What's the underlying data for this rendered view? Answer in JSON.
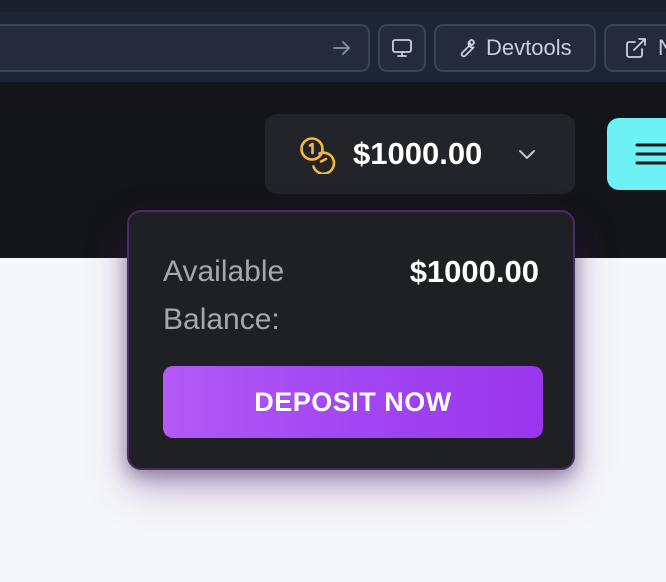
{
  "browser": {
    "url_value": "",
    "devtools_label": "Devtools",
    "new_label": "N",
    "icons": [
      "arrow-right-icon",
      "monitor-icon",
      "wrench-icon",
      "external-link-icon"
    ]
  },
  "header": {
    "balance_amount": "$1000.00",
    "icons": [
      "coins-icon",
      "chevron-down-icon",
      "menu-icon"
    ],
    "colors": {
      "header_bg": "#141518",
      "menu_button": "#6cf2f4",
      "coin": "#f5b83d"
    }
  },
  "balance_popover": {
    "label": "Available Balance:",
    "value": "$1000.00",
    "deposit_label": "DEPOSIT NOW",
    "colors": {
      "deposit_gradient_start": "#b25af6",
      "deposit_gradient_end": "#9a36ee",
      "border": "#4a2a6a"
    }
  }
}
